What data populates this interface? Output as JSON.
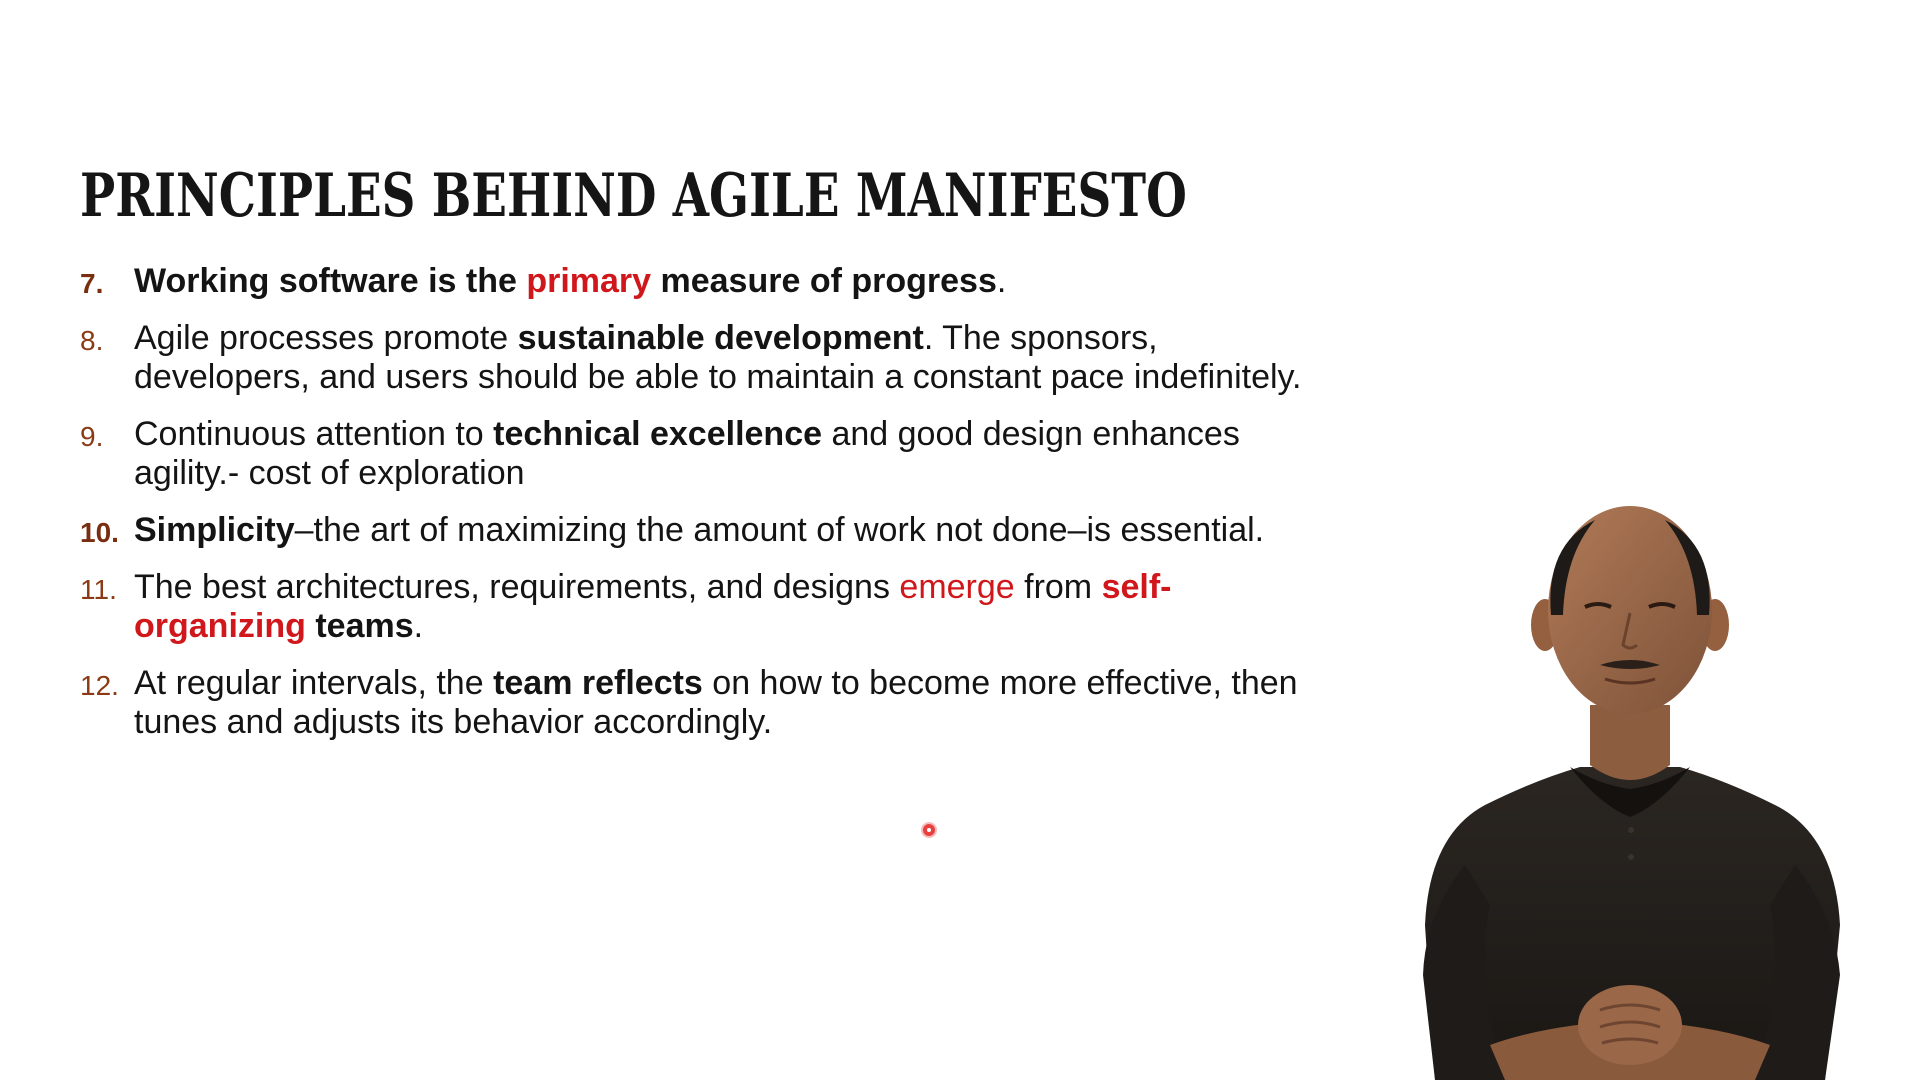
{
  "slide": {
    "title": "PRINCIPLES BEHIND AGILE MANIFESTO",
    "principles": [
      {
        "number": "7.",
        "segments": [
          {
            "text": "Working software is the ",
            "style": "bold"
          },
          {
            "text": "primary",
            "style": "red-bold"
          },
          {
            "text": " measure of progress",
            "style": "bold"
          },
          {
            "text": ".",
            "style": "normal"
          }
        ]
      },
      {
        "number": "8.",
        "segments": [
          {
            "text": "Agile processes promote ",
            "style": "normal"
          },
          {
            "text": "sustainable development",
            "style": "bold"
          },
          {
            "text": ". The sponsors, developers, and users should be able to maintain a constant pace indefinitely.",
            "style": "normal"
          }
        ]
      },
      {
        "number": "9.",
        "segments": [
          {
            "text": "Continuous attention to ",
            "style": "normal"
          },
          {
            "text": "technical excellence",
            "style": "bold"
          },
          {
            "text": " and good design enhances agility.- cost of exploration",
            "style": "normal"
          }
        ]
      },
      {
        "number": "10.",
        "segments": [
          {
            "text": "Simplicity",
            "style": "bold"
          },
          {
            "text": "–the art of maximizing the amount of work not done–is essential.",
            "style": "normal"
          }
        ]
      },
      {
        "number": "11.",
        "segments": [
          {
            "text": "The best architectures, requirements, and designs ",
            "style": "normal"
          },
          {
            "text": "emerge",
            "style": "red"
          },
          {
            "text": " from ",
            "style": "normal"
          },
          {
            "text": "self-organizing",
            "style": "red-bold"
          },
          {
            "text": " teams",
            "style": "bold"
          },
          {
            "text": ".",
            "style": "normal"
          }
        ]
      },
      {
        "number": "12.",
        "segments": [
          {
            "text": "At regular intervals, the ",
            "style": "normal"
          },
          {
            "text": "team reflects",
            "style": "bold"
          },
          {
            "text": " on how to become more effective, then tunes and adjusts its behavior accordingly.",
            "style": "normal"
          }
        ]
      }
    ]
  },
  "colors": {
    "accent_red": "#d0181c",
    "number_brown": "#8a3a14",
    "text": "#141414"
  },
  "presenter": {
    "icon": "presenter-figure"
  }
}
